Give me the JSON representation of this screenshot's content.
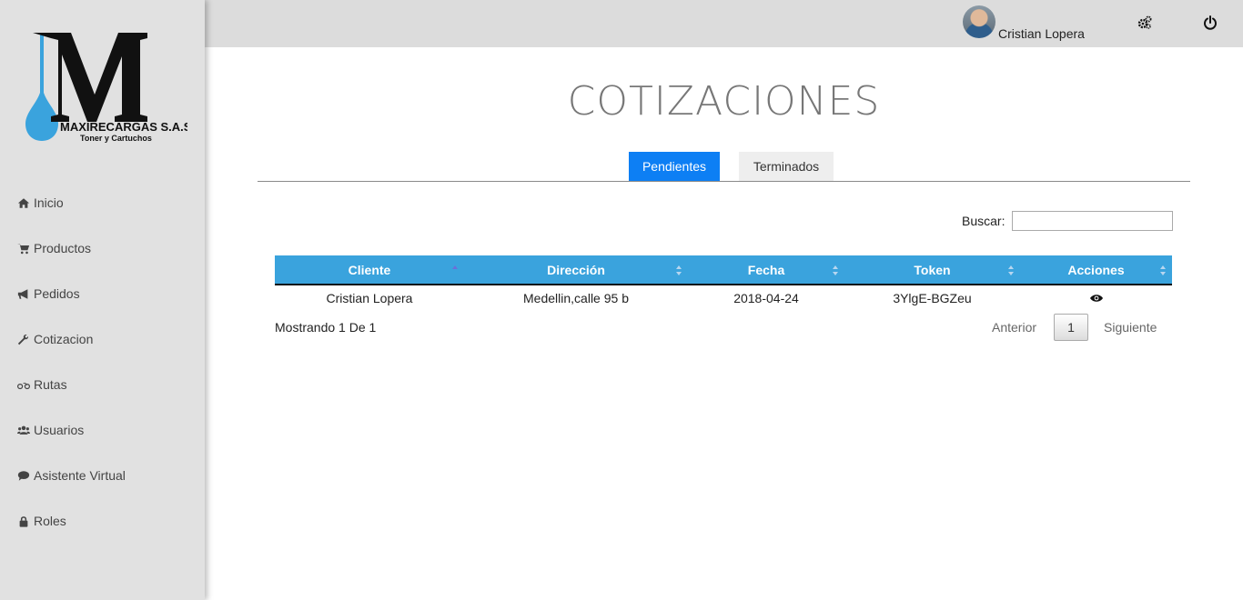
{
  "brand": {
    "name": "MAXIRECARGAS S.A.S",
    "tagline": "Toner y Cartuchos",
    "accent_color": "#3aa3dd"
  },
  "sidebar": {
    "items": [
      {
        "label": "Inicio",
        "icon": "home-icon"
      },
      {
        "label": "Productos",
        "icon": "cart-icon"
      },
      {
        "label": "Pedidos",
        "icon": "bullhorn-icon"
      },
      {
        "label": "Cotizacion",
        "icon": "wrench-icon"
      },
      {
        "label": "Rutas",
        "icon": "motorcycle-icon"
      },
      {
        "label": "Usuarios",
        "icon": "users-icon"
      },
      {
        "label": "Asistente Virtual",
        "icon": "chat-icon"
      },
      {
        "label": "Roles",
        "icon": "lock-icon"
      }
    ]
  },
  "header": {
    "user_name": "Cristian Lopera",
    "settings_icon": "gears-icon",
    "logout_icon": "power-icon"
  },
  "main": {
    "title": "COTIZACIONES",
    "tabs": [
      {
        "label": "Pendientes",
        "active": true,
        "color": "#0d7ff4"
      },
      {
        "label": "Terminados",
        "active": false
      }
    ],
    "search": {
      "label": "Buscar:",
      "value": ""
    },
    "table": {
      "columns": [
        "Cliente",
        "Dirección",
        "Fecha",
        "Token",
        "Acciones"
      ],
      "rows": [
        {
          "cliente": "Cristian Lopera",
          "direccion": "Medellin,calle 95 b",
          "fecha": "2018-04-24",
          "token": "3YlgE-BGZeu",
          "accion_icon": "eye-icon"
        }
      ]
    },
    "info": "Mostrando 1 De 1",
    "pagination": {
      "prev": "Anterior",
      "page": "1",
      "next": "Siguiente"
    }
  }
}
